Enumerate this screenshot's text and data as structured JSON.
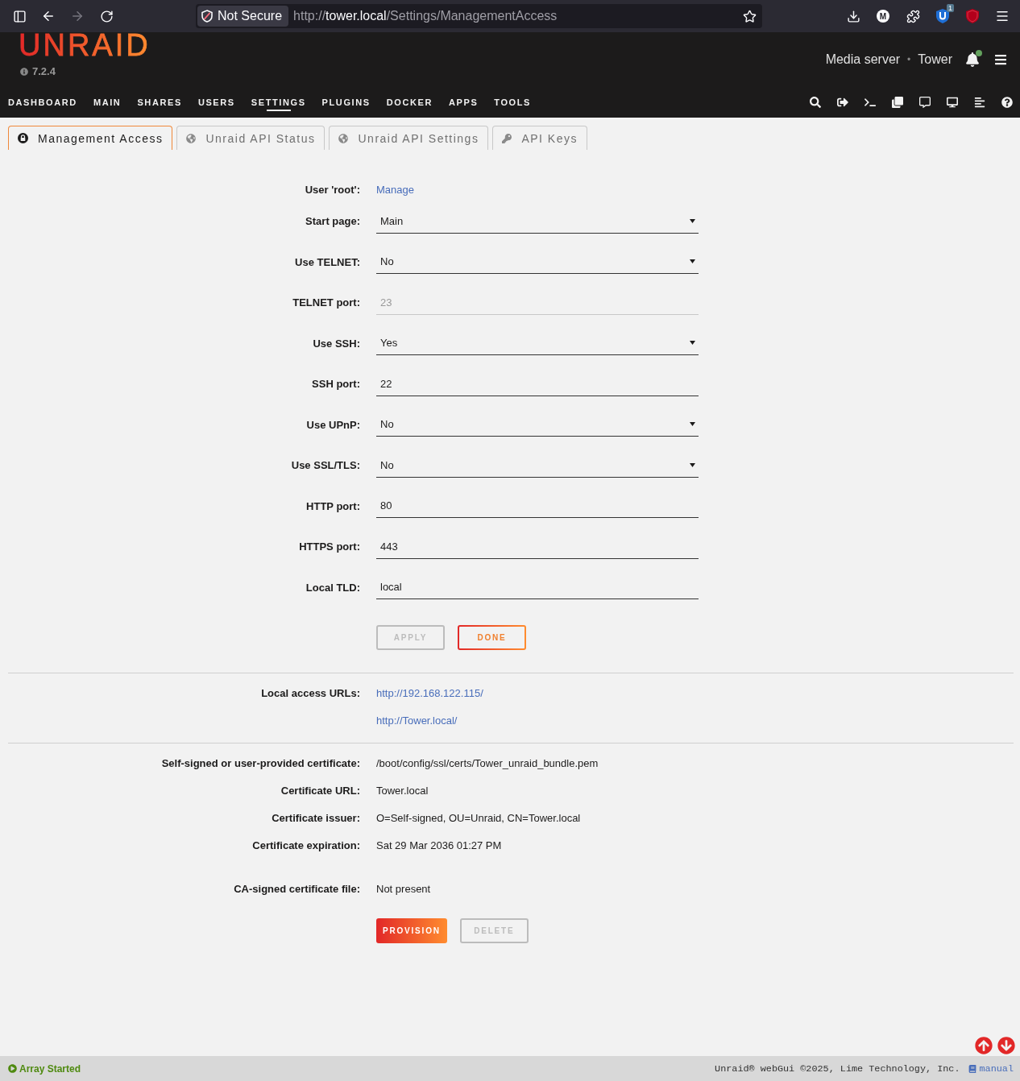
{
  "browser": {
    "back": {
      "disabled": false
    },
    "forward": {
      "disabled": true
    },
    "security": "Not Secure",
    "url": {
      "scheme": "http://",
      "host": "tower.local",
      "path": "/Settings/ManagementAccess"
    },
    "extension_letter": "M",
    "extension_badge": "1"
  },
  "header": {
    "logo": "UNRAID",
    "version": "7.2.4",
    "server_description": "Media server",
    "separator": "•",
    "server_name": "Tower"
  },
  "nav": [
    {
      "label": "DASHBOARD",
      "selected": false
    },
    {
      "label": "MAIN",
      "selected": false
    },
    {
      "label": "SHARES",
      "selected": false
    },
    {
      "label": "USERS",
      "selected": false
    },
    {
      "label": "SETTINGS",
      "selected": true
    },
    {
      "label": "PLUGINS",
      "selected": false
    },
    {
      "label": "DOCKER",
      "selected": false
    },
    {
      "label": "APPS",
      "selected": false
    },
    {
      "label": "TOOLS",
      "selected": false
    }
  ],
  "tabs": [
    {
      "label": "Management Access",
      "selected": true
    },
    {
      "label": "Unraid API Status",
      "selected": false
    },
    {
      "label": "Unraid API Settings",
      "selected": false
    },
    {
      "label": "API Keys",
      "selected": false
    }
  ],
  "form": {
    "rows": [
      {
        "label": "User 'root':",
        "kind": "link",
        "value": "Manage",
        "disabled": false
      },
      {
        "label": "Start page:",
        "kind": "select",
        "value": "Main",
        "disabled": false
      },
      {
        "label": "Use TELNET:",
        "kind": "select",
        "value": "No",
        "disabled": false
      },
      {
        "label": "TELNET port:",
        "kind": "input",
        "value": "23",
        "disabled": true
      },
      {
        "label": "Use SSH:",
        "kind": "select",
        "value": "Yes",
        "disabled": false
      },
      {
        "label": "SSH port:",
        "kind": "input",
        "value": "22",
        "disabled": false
      },
      {
        "label": "Use UPnP:",
        "kind": "select",
        "value": "No",
        "disabled": false
      },
      {
        "label": "Use SSL/TLS:",
        "kind": "select",
        "value": "No",
        "disabled": false
      },
      {
        "label": "HTTP port:",
        "kind": "input",
        "value": "80",
        "disabled": false
      },
      {
        "label": "HTTPS port:",
        "kind": "input",
        "value": "443",
        "disabled": false
      },
      {
        "label": "Local TLD:",
        "kind": "input",
        "value": "local",
        "disabled": false
      }
    ],
    "buttons": [
      {
        "label": "APPLY",
        "kind": "outline",
        "disabled": true
      },
      {
        "label": "DONE",
        "kind": "outline",
        "disabled": false
      }
    ]
  },
  "access": {
    "label": "Local access URLs:",
    "links": [
      "http://192.168.122.115/",
      "http://Tower.local/"
    ]
  },
  "certificate": {
    "rows": [
      {
        "label": "Self-signed or user-provided certificate:",
        "value": "/boot/config/ssl/certs/Tower_unraid_bundle.pem"
      },
      {
        "label": "Certificate URL:",
        "value": "Tower.local"
      },
      {
        "label": "Certificate issuer:",
        "value": "O=Self-signed, OU=Unraid, CN=Tower.local"
      },
      {
        "label": "Certificate expiration:",
        "value": "Sat 29 Mar 2036 01:27 PM"
      }
    ],
    "ca_file": {
      "label": "CA-signed certificate file:",
      "value": "Not present"
    },
    "buttons": [
      {
        "label": "PROVISION",
        "kind": "filled",
        "disabled": false
      },
      {
        "label": "DELETE",
        "kind": "outline",
        "disabled": true
      }
    ]
  },
  "footer": {
    "status": "Array Started",
    "copyright": "Unraid® webGui ©2025, Lime Technology, Inc.",
    "manual": "manual"
  }
}
